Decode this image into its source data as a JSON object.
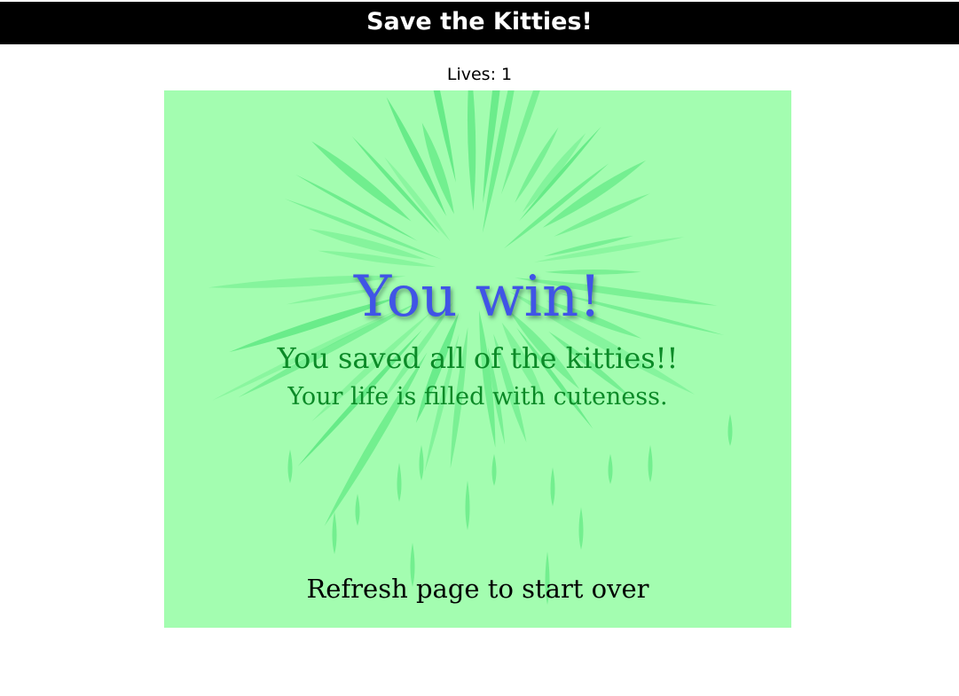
{
  "header": {
    "title": "Save the Kitties!"
  },
  "status": {
    "lives_label": "Lives: 1"
  },
  "game": {
    "win_title": "You win!",
    "win_message_1": "You saved all of the kitties!!",
    "win_message_2": "Your life is filled with cuteness.",
    "refresh_hint": "Refresh page to start over"
  },
  "colors": {
    "title_bar": "#000000",
    "panel_background": "#a3fdb0",
    "firework": "#5ee882",
    "win_title": "#4054e6",
    "win_message": "#0b8a27"
  },
  "icons": {
    "background": "firework-burst-icon"
  }
}
